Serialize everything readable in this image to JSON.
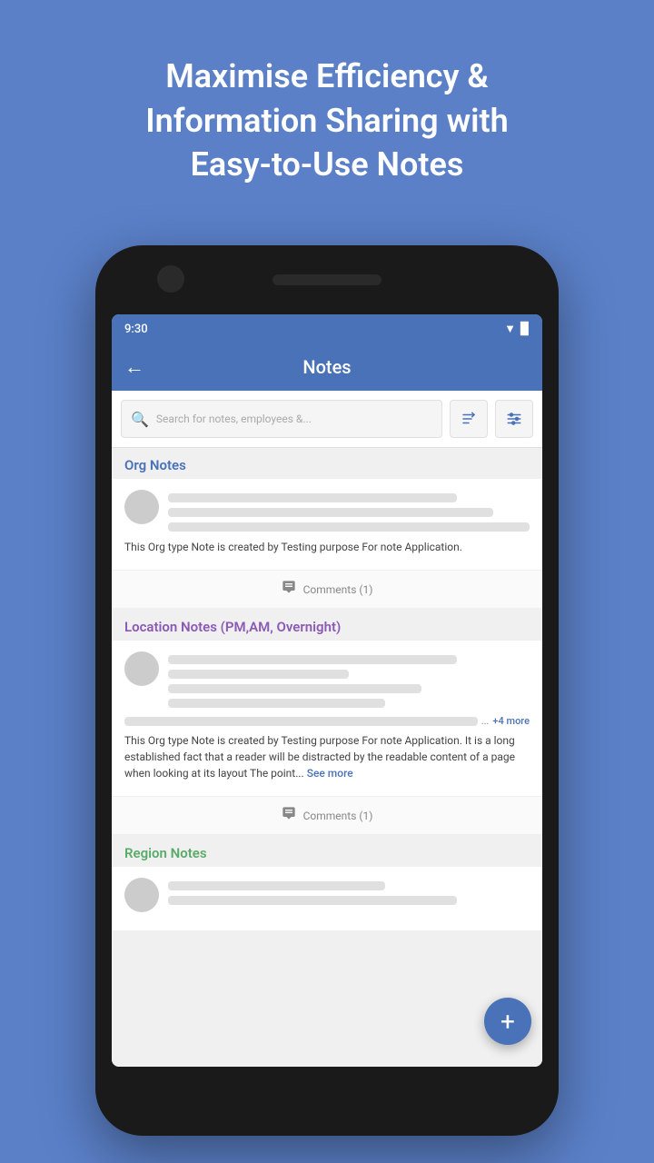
{
  "hero": {
    "line1": "Maximise Efficiency &",
    "line2": "Information Sharing with",
    "line3": "Easy-to-Use Notes"
  },
  "status_bar": {
    "time": "9:30",
    "wifi": "▼▲",
    "signal": "▉"
  },
  "app_bar": {
    "back_label": "←",
    "title": "Notes"
  },
  "search": {
    "placeholder": "Search for notes, employees &...",
    "sort_icon": "sort",
    "filter_icon": "filter"
  },
  "sections": [
    {
      "id": "org",
      "header": "Org Notes",
      "color_class": "blue",
      "note_text": "This Org type Note is created by Testing purpose For note Application.",
      "comments": "Comments (1)",
      "has_more": false,
      "has_see_more": false
    },
    {
      "id": "location",
      "header": "Location Notes (PM,AM, Overnight)",
      "color_class": "purple",
      "note_text": "This Org type Note is created by Testing purpose For note Application. It is a long established fact that a reader will be distracted by the readable content of a page when looking at its layout The point...",
      "see_more_label": "See more",
      "more_tag": "+4 more",
      "comments": "Comments (1)",
      "has_more": true,
      "has_see_more": true
    },
    {
      "id": "region",
      "header": "Region Notes",
      "color_class": "green",
      "note_text": "",
      "has_more": false,
      "has_see_more": false
    }
  ],
  "fab": {
    "label": "+"
  }
}
